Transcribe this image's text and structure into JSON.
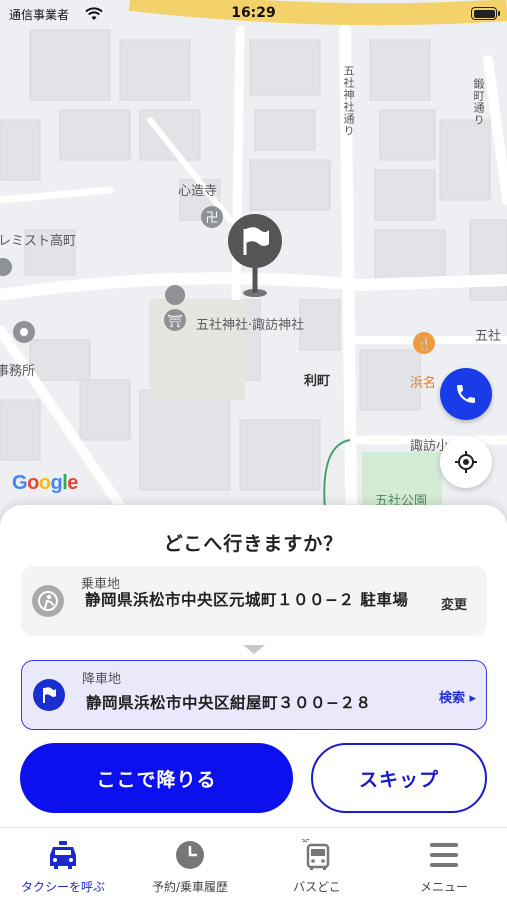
{
  "status_bar": {
    "carrier": "通信事業者",
    "time": "16:29"
  },
  "map": {
    "labels": {
      "temple": "心造寺",
      "shrine": "五社神社·諏訪神社",
      "area": "利町",
      "left_building": "レミスト高町",
      "office": "事務所",
      "restaurant": "浜名",
      "suwa": "諏訪小",
      "park": "五社公園",
      "gosha_right": "五社",
      "street_gosha": "五社神社通り",
      "street_right": "鍛町通り"
    },
    "google_logo": [
      "G",
      "o",
      "o",
      "g",
      "l",
      "e"
    ]
  },
  "sheet": {
    "title": "どこへ行きますか？",
    "pickup": {
      "label": "乗車地",
      "address": "静岡県浜松市中央区元城町１００−２ 駐車場",
      "action": "変更"
    },
    "dropoff": {
      "label": "降車地",
      "address": "静岡県浜松市中央区紺屋町３００−２８",
      "action": "検索 ▸"
    },
    "primary_button": "ここで降りる",
    "secondary_button": "スキップ"
  },
  "tabs": [
    {
      "label": "タクシーを呼ぶ",
      "icon": "taxi-icon",
      "active": true
    },
    {
      "label": "予約/乗車履歴",
      "icon": "clock-icon",
      "active": false
    },
    {
      "label": "バスどこ",
      "icon": "bus-icon",
      "active": false
    },
    {
      "label": "メニュー",
      "icon": "menu-icon",
      "active": false
    }
  ],
  "colors": {
    "accent": "#0c10ee",
    "active_tab": "#1a2acb",
    "pin": "#555555",
    "phone": "#1a3be8"
  }
}
